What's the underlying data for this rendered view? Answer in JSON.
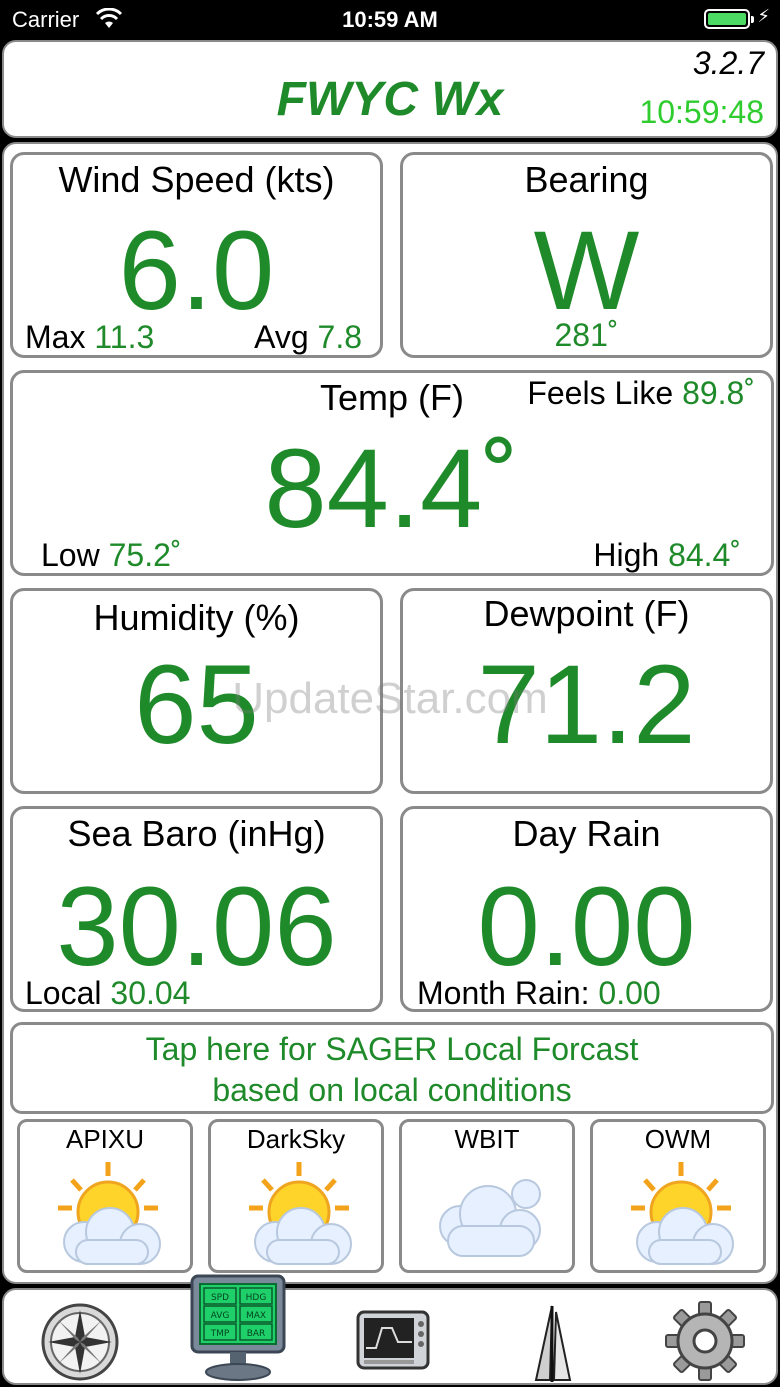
{
  "status_bar": {
    "carrier": "Carrier",
    "time": "10:59 AM",
    "battery_level": 1.0
  },
  "header": {
    "title": "FWYC Wx",
    "version": "3.2.7",
    "clock": "10:59:48"
  },
  "wind": {
    "label": "Wind Speed (kts)",
    "value": "6.0",
    "max_label": "Max",
    "max_value": "11.3",
    "avg_label": "Avg",
    "avg_value": "7.8"
  },
  "bearing": {
    "label": "Bearing",
    "direction": "W",
    "degrees": "281˚"
  },
  "temp": {
    "label": "Temp (F)",
    "value": "84.4˚",
    "feels_label": "Feels Like",
    "feels_value": "89.8˚",
    "low_label": "Low",
    "low_value": "75.2˚",
    "high_label": "High",
    "high_value": "84.4˚"
  },
  "humidity": {
    "label": "Humidity (%)",
    "value": "65"
  },
  "dewpoint": {
    "label": "Dewpoint (F)",
    "value": "71.2"
  },
  "baro": {
    "label": "Sea Baro (inHg)",
    "value": "30.06",
    "local_label": "Local",
    "local_value": "30.04"
  },
  "rain": {
    "label": "Day Rain",
    "value": "0.00",
    "month_label": "Month Rain:",
    "month_value": "0.00"
  },
  "sager": {
    "line1": "Tap here for SAGER Local Forcast",
    "line2": "based on local conditions"
  },
  "forecasts": [
    {
      "name": "APIXU",
      "icon": "partly-sunny-icon"
    },
    {
      "name": "DarkSky",
      "icon": "partly-sunny-icon"
    },
    {
      "name": "WBIT",
      "icon": "cloudy-icon"
    },
    {
      "name": "OWM",
      "icon": "partly-sunny-icon"
    }
  ],
  "tabs": [
    {
      "name": "compass",
      "icon": "compass-icon"
    },
    {
      "name": "dashboard",
      "icon": "monitor-dashboard-icon",
      "monitor_labels": [
        "SPD",
        "HDG",
        "AVG",
        "MAX",
        "TMP",
        "BAR"
      ]
    },
    {
      "name": "graph",
      "icon": "graph-monitor-icon"
    },
    {
      "name": "sails",
      "icon": "sailboat-icon"
    },
    {
      "name": "settings",
      "icon": "gear-icon"
    }
  ],
  "watermark": "UpdateStar.com",
  "colors": {
    "accent_green": "#1f8a2a",
    "clock_green": "#2ecc2e",
    "border_gray": "#8a8a8a"
  }
}
